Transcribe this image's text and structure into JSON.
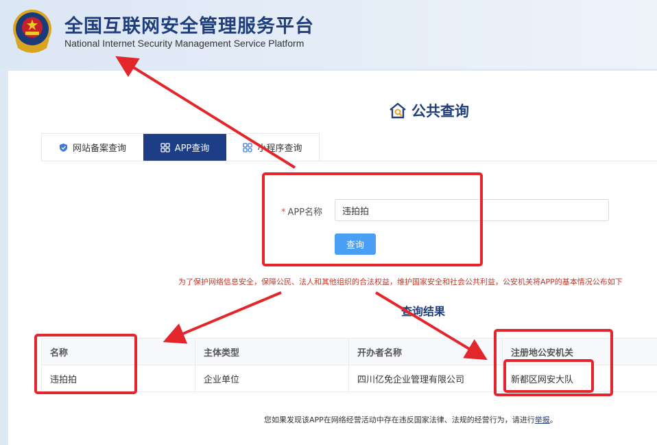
{
  "header": {
    "title": "全国互联网安全管理服务平台",
    "subtitle": "National Internet Security Management Service Platform"
  },
  "page": {
    "title": "公共查询"
  },
  "tabs": [
    {
      "label": "网站备案查询",
      "icon": "shield-icon",
      "active": false
    },
    {
      "label": "APP查询",
      "icon": "grid-apps-icon",
      "active": true
    },
    {
      "label": "小程序查询",
      "icon": "mini-program-icon",
      "active": false
    }
  ],
  "form": {
    "required_mark": "*",
    "label": "APP名称",
    "value": "违拍拍",
    "submit_label": "查询"
  },
  "notice": "为了保护网络信息安全，保障公民、法人和其他组织的合法权益，维护国家安全和社会公共利益，公安机关将APP的基本情况公布如下",
  "results": {
    "title": "查询结果",
    "columns": [
      "名称",
      "主体类型",
      "开办者名称",
      "注册地公安机关"
    ],
    "rows": [
      [
        "违拍拍",
        "企业单位",
        "四川亿免企业管理有限公司",
        "新都区网安大队"
      ]
    ]
  },
  "footer": {
    "text": "您如果发现该APP在网络经营活动中存在违反国家法律、法规的经营行为，请进行",
    "link": "举报",
    "end": "。"
  },
  "colors": {
    "brand": "#1f3d7a",
    "active_tab": "#1d3d87",
    "button": "#4a9ff5",
    "annotation": "#e3262b",
    "notice": "#c0392b"
  }
}
